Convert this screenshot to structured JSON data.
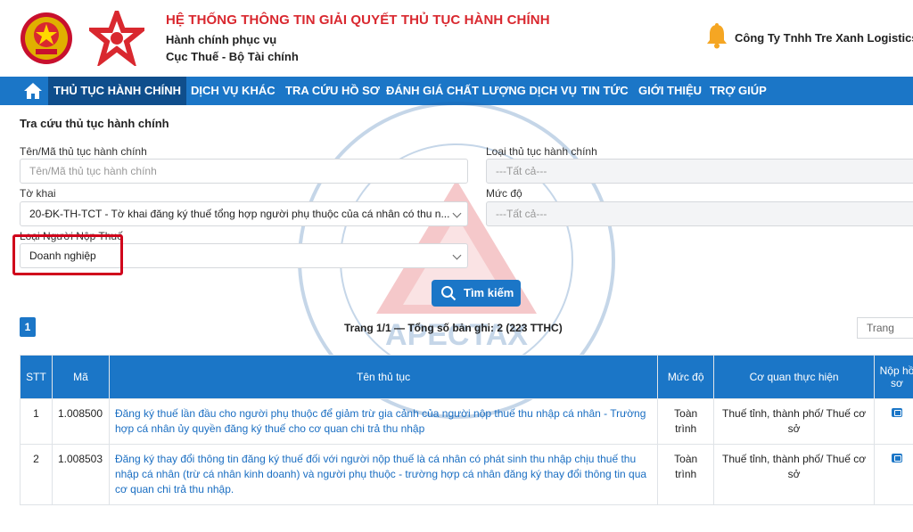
{
  "header": {
    "title": "HỆ THỐNG THÔNG TIN GIẢI QUYẾT THỦ TỤC HÀNH CHÍNH",
    "subtitle1": "Hành chính phục vụ",
    "subtitle2": "Cục Thuế - Bộ Tài chính",
    "company": "Công Ty Tnhh Tre Xanh Logistics"
  },
  "nav": {
    "items": [
      {
        "label": "THỦ TỤC HÀNH CHÍNH"
      },
      {
        "label": "DỊCH VỤ KHÁC"
      },
      {
        "label": "TRA CỨU HỒ SƠ"
      },
      {
        "label": "ĐÁNH GIÁ CHẤT LƯỢNG DỊCH VỤ"
      },
      {
        "label": "TIN TỨC"
      },
      {
        "label": "GIỚI THIỆU"
      },
      {
        "label": "TRỢ GIÚP"
      }
    ]
  },
  "form": {
    "title": "Tra cứu thủ tục hành chính",
    "name_label": "Tên/Mã thủ tục hành chính",
    "name_placeholder": "Tên/Mã thủ tục hành chính",
    "type_label": "Loại thủ tục hành chính",
    "type_value": "---Tất cả---",
    "declaration_label": "Tờ khai",
    "declaration_value": "20-ĐK-TH-TCT - Tờ khai đăng ký thuế tổng hợp người phụ thuộc của cá nhân có thu n...",
    "level_label": "Mức độ",
    "level_value": "---Tất cả---",
    "taxpayer_label": "Loại Người Nộp Thuế",
    "taxpayer_value": "Doanh nghiệp",
    "search_label": "Tìm kiếm"
  },
  "pagination": {
    "current": "1",
    "info": "Trang 1/1 — Tổng số bản ghi: 2 (223 TTHC)",
    "page_select": "Trang"
  },
  "table": {
    "headers": [
      "STT",
      "Mã",
      "Tên thủ tục",
      "Mức độ",
      "Cơ quan thực hiện",
      "Nộp hồ sơ"
    ],
    "rows": [
      {
        "stt": "1",
        "code": "1.008500",
        "name": "Đăng ký thuế lần đầu cho người phụ thuộc để giảm trừ gia cảnh của người nộp thuế thu nhập cá nhân - Trường hợp cá nhân ủy quyền đăng ký thuế cho cơ quan chi trả thu nhập",
        "level": "Toàn trình",
        "agency": "Thuế tỉnh, thành phố/ Thuế cơ sở"
      },
      {
        "stt": "2",
        "code": "1.008503",
        "name": "Đăng ký thay đổi thông tin đăng ký thuế đối với người nộp thuế là cá nhân có phát sinh thu nhập chịu thuế thu nhập cá nhân (trừ cá nhân kinh doanh) và người phụ thuộc - trường hợp cá nhân đăng ký thay đổi thông tin qua cơ quan chi trả thu nhập.",
        "level": "Toàn trình",
        "agency": "Thuế tỉnh, thành phố/ Thuế cơ sở"
      }
    ]
  },
  "watermark": {
    "brand": "APECTAX"
  },
  "colors": {
    "primary": "#1b76c7",
    "nav_active": "#0f4e8c",
    "title_red": "#d9282f",
    "highlight": "#d0021b"
  }
}
